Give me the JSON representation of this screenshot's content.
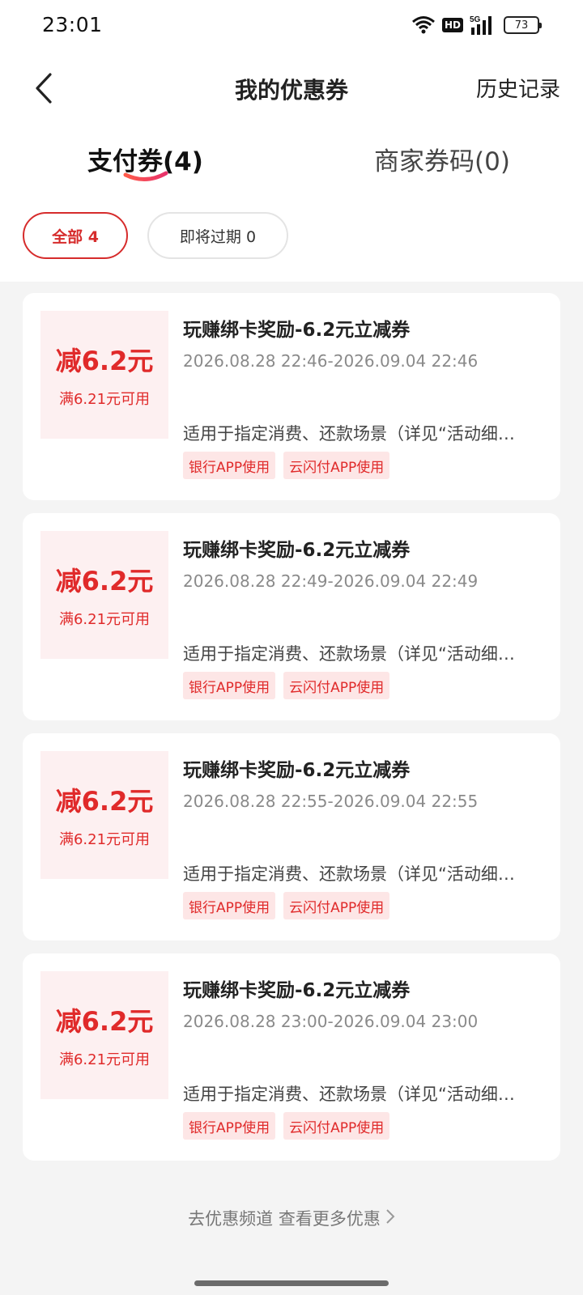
{
  "status_bar": {
    "time": "23:01",
    "network": "5G",
    "hd": "HD",
    "battery": "73"
  },
  "header": {
    "title": "我的优惠券",
    "history_link": "历史记录",
    "back_icon": "back-chevron-icon"
  },
  "tabs": [
    {
      "label": "支付券(4)",
      "active": true
    },
    {
      "label": "商家券码(0)",
      "active": false
    }
  ],
  "filters": [
    {
      "label": "全部 4",
      "active": true
    },
    {
      "label": "即将过期 0",
      "active": false
    }
  ],
  "coupons": [
    {
      "amount": "减6.2元",
      "threshold": "满6.21元可用",
      "title": "玩赚绑卡奖励-6.2元立减券",
      "validity": "2026.08.28 22:46-2026.09.04 22:46",
      "description": "适用于指定消费、还款场景（详见“活动细…",
      "tags": [
        "银行APP使用",
        "云闪付APP使用"
      ]
    },
    {
      "amount": "减6.2元",
      "threshold": "满6.21元可用",
      "title": "玩赚绑卡奖励-6.2元立减券",
      "validity": "2026.08.28 22:49-2026.09.04 22:49",
      "description": "适用于指定消费、还款场景（详见“活动细…",
      "tags": [
        "银行APP使用",
        "云闪付APP使用"
      ]
    },
    {
      "amount": "减6.2元",
      "threshold": "满6.21元可用",
      "title": "玩赚绑卡奖励-6.2元立减券",
      "validity": "2026.08.28 22:55-2026.09.04 22:55",
      "description": "适用于指定消费、还款场景（详见“活动细…",
      "tags": [
        "银行APP使用",
        "云闪付APP使用"
      ]
    },
    {
      "amount": "减6.2元",
      "threshold": "满6.21元可用",
      "title": "玩赚绑卡奖励-6.2元立减券",
      "validity": "2026.08.28 23:00-2026.09.04 23:00",
      "description": "适用于指定消费、还款场景（详见“活动细…",
      "tags": [
        "银行APP使用",
        "云闪付APP使用"
      ]
    }
  ],
  "more_link": "去优惠频道 查看更多优惠",
  "colors": {
    "accent": "#e02a2a",
    "amount_bg": "#fdf0f1",
    "list_bg": "#f4f4f4"
  }
}
